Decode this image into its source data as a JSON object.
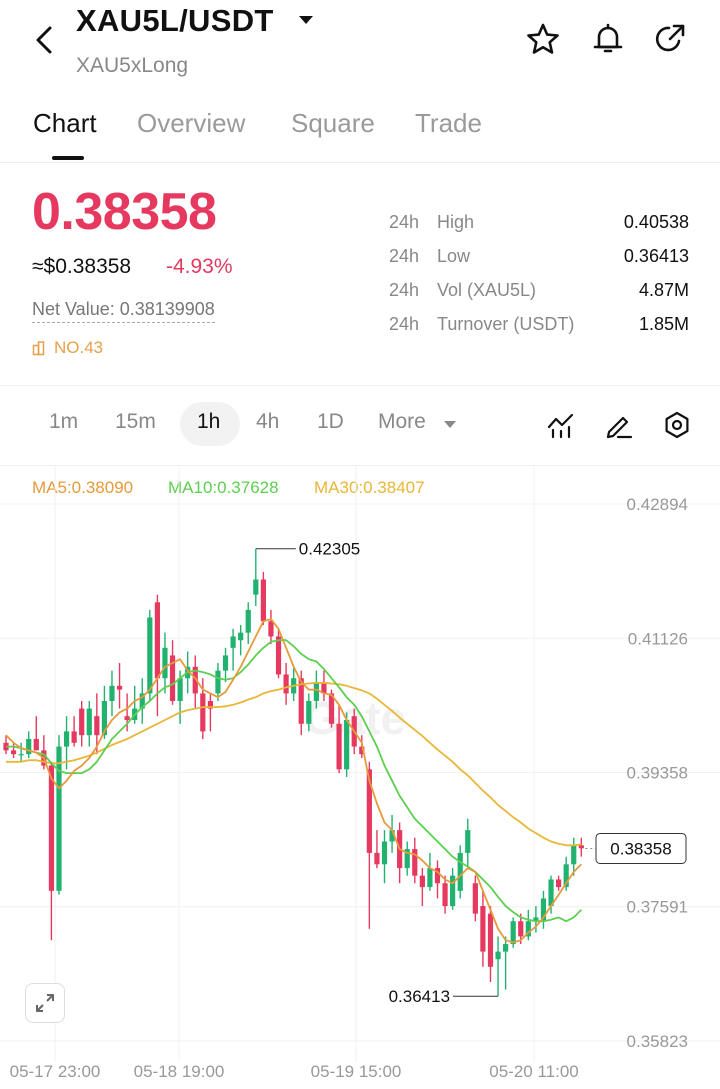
{
  "header": {
    "pair": "XAU5L/USDT",
    "subtitle": "XAU5xLong",
    "icons": [
      "back-arrow-icon",
      "star-icon",
      "bell-icon",
      "share-icon"
    ]
  },
  "tabs": [
    {
      "label": "Chart",
      "active": true
    },
    {
      "label": "Overview",
      "active": false
    },
    {
      "label": "Square",
      "active": false
    },
    {
      "label": "Trade",
      "active": false
    }
  ],
  "ticker": {
    "price": "0.38358",
    "usd_price": "≈$0.38358",
    "change": "-4.93%",
    "net_value": "Net Value: 0.38139908",
    "rank": "NO.43",
    "colors": {
      "down": "#e5395f",
      "up": "#21b26f",
      "rank": "#e7a04a"
    }
  },
  "stats": [
    {
      "period": "24h",
      "label": "High",
      "value": "0.40538"
    },
    {
      "period": "24h",
      "label": "Low",
      "value": "0.36413"
    },
    {
      "period": "24h",
      "label": "Vol (XAU5L)",
      "value": "4.87M"
    },
    {
      "period": "24h",
      "label": "Turnover (USDT)",
      "value": "1.85M"
    }
  ],
  "timeframes": [
    {
      "label": "1m",
      "active": false
    },
    {
      "label": "15m",
      "active": false
    },
    {
      "label": "1h",
      "active": true
    },
    {
      "label": "4h",
      "active": false
    },
    {
      "label": "1D",
      "active": false
    },
    {
      "label": "More",
      "active": false
    }
  ],
  "toolbar_icons": [
    "indicator-icon",
    "draw-pen-icon",
    "settings-hex-icon"
  ],
  "chart_data": {
    "type": "candlestick",
    "moving_averages": [
      {
        "name": "MA5",
        "value": "0.38090",
        "label": "MA5:0.38090",
        "color": "#e79a3c"
      },
      {
        "name": "MA10",
        "value": "0.37628",
        "label": "MA10:0.37628",
        "color": "#5ccf4f"
      },
      {
        "name": "MA30",
        "value": "0.38407",
        "label": "MA30:0.38407",
        "color": "#e9b637"
      }
    ],
    "y_ticks": [
      "0.42894",
      "0.41126",
      "0.39358",
      "0.37591",
      "0.35823"
    ],
    "x_ticks": [
      "05-17 23:00",
      "05-18 19:00",
      "05-19 15:00",
      "05-20 11:00"
    ],
    "ylim": [
      0.35823,
      0.42894
    ],
    "high_marker": "0.42305",
    "low_marker": "0.36413",
    "last_price": "0.38358",
    "watermark": "Gate",
    "candles": [
      [
        0.3975,
        0.3985,
        0.396,
        0.3965
      ],
      [
        0.3965,
        0.3975,
        0.3955,
        0.396
      ],
      [
        0.396,
        0.3975,
        0.395,
        0.396
      ],
      [
        0.396,
        0.399,
        0.3955,
        0.398
      ],
      [
        0.398,
        0.401,
        0.3965,
        0.3965
      ],
      [
        0.3965,
        0.3985,
        0.394,
        0.3945
      ],
      [
        0.3945,
        0.395,
        0.3715,
        0.378
      ],
      [
        0.378,
        0.3985,
        0.3775,
        0.397
      ],
      [
        0.397,
        0.401,
        0.394,
        0.399
      ],
      [
        0.399,
        0.401,
        0.397,
        0.3975
      ],
      [
        0.402,
        0.403,
        0.397,
        0.3985
      ],
      [
        0.3985,
        0.403,
        0.397,
        0.402
      ],
      [
        0.401,
        0.404,
        0.396,
        0.3985
      ],
      [
        0.3985,
        0.405,
        0.398,
        0.403
      ],
      [
        0.403,
        0.407,
        0.401,
        0.405
      ],
      [
        0.405,
        0.408,
        0.402,
        0.4045
      ],
      [
        0.401,
        0.404,
        0.399,
        0.4005
      ],
      [
        0.4005,
        0.405,
        0.4,
        0.402
      ],
      [
        0.402,
        0.406,
        0.4,
        0.404
      ],
      [
        0.404,
        0.415,
        0.403,
        0.414
      ],
      [
        0.416,
        0.417,
        0.401,
        0.406
      ],
      [
        0.406,
        0.412,
        0.404,
        0.41
      ],
      [
        0.409,
        0.411,
        0.4025,
        0.403
      ],
      [
        0.403,
        0.407,
        0.4,
        0.406
      ],
      [
        0.406,
        0.4095,
        0.404,
        0.4075
      ],
      [
        0.4075,
        0.409,
        0.402,
        0.404
      ],
      [
        0.404,
        0.406,
        0.398,
        0.399
      ],
      [
        0.403,
        0.404,
        0.399,
        0.402
      ],
      [
        0.404,
        0.408,
        0.403,
        0.407
      ],
      [
        0.407,
        0.41,
        0.4055,
        0.409
      ],
      [
        0.41,
        0.4125,
        0.407,
        0.4115
      ],
      [
        0.411,
        0.413,
        0.409,
        0.412
      ],
      [
        0.412,
        0.416,
        0.4105,
        0.415
      ],
      [
        0.417,
        0.42305,
        0.4155,
        0.419
      ],
      [
        0.419,
        0.42,
        0.413,
        0.4135
      ],
      [
        0.4135,
        0.415,
        0.4105,
        0.4115
      ],
      [
        0.4115,
        0.4125,
        0.406,
        0.4065
      ],
      [
        0.4065,
        0.408,
        0.4025,
        0.404
      ],
      [
        0.404,
        0.4075,
        0.403,
        0.406
      ],
      [
        0.406,
        0.407,
        0.3985,
        0.4
      ],
      [
        0.4,
        0.404,
        0.399,
        0.403
      ],
      [
        0.403,
        0.407,
        0.402,
        0.4055
      ],
      [
        0.4055,
        0.407,
        0.403,
        0.404
      ],
      [
        0.404,
        0.4045,
        0.3995,
        0.4
      ],
      [
        0.4,
        0.4025,
        0.3935,
        0.394
      ],
      [
        0.394,
        0.4015,
        0.393,
        0.4005
      ],
      [
        0.401,
        0.402,
        0.396,
        0.397
      ],
      [
        0.397,
        0.3985,
        0.3955,
        0.396
      ],
      [
        0.394,
        0.395,
        0.373,
        0.383
      ],
      [
        0.383,
        0.386,
        0.381,
        0.3815
      ],
      [
        0.3815,
        0.386,
        0.379,
        0.3845
      ],
      [
        0.3845,
        0.388,
        0.383,
        0.386
      ],
      [
        0.386,
        0.387,
        0.379,
        0.381
      ],
      [
        0.381,
        0.3845,
        0.38,
        0.3835
      ],
      [
        0.3835,
        0.385,
        0.379,
        0.38
      ],
      [
        0.38,
        0.381,
        0.376,
        0.3785
      ],
      [
        0.3785,
        0.383,
        0.378,
        0.381
      ],
      [
        0.381,
        0.382,
        0.377,
        0.379
      ],
      [
        0.379,
        0.38,
        0.375,
        0.376
      ],
      [
        0.376,
        0.381,
        0.3755,
        0.38
      ],
      [
        0.378,
        0.384,
        0.377,
        0.383
      ],
      [
        0.383,
        0.3875,
        0.381,
        0.386
      ],
      [
        0.379,
        0.38,
        0.374,
        0.375
      ],
      [
        0.376,
        0.378,
        0.368,
        0.37
      ],
      [
        0.375,
        0.376,
        0.366,
        0.368
      ],
      [
        0.369,
        0.372,
        0.36413,
        0.37
      ],
      [
        0.37,
        0.372,
        0.365,
        0.371
      ],
      [
        0.371,
        0.3745,
        0.3705,
        0.374
      ],
      [
        0.374,
        0.375,
        0.371,
        0.372
      ],
      [
        0.372,
        0.3755,
        0.3715,
        0.374
      ],
      [
        0.374,
        0.376,
        0.3725,
        0.3745
      ],
      [
        0.374,
        0.378,
        0.373,
        0.377
      ],
      [
        0.376,
        0.38,
        0.375,
        0.3795
      ],
      [
        0.3795,
        0.38,
        0.378,
        0.3785
      ],
      [
        0.3785,
        0.3825,
        0.378,
        0.3815
      ],
      [
        0.3815,
        0.385,
        0.38,
        0.384
      ],
      [
        0.384,
        0.385,
        0.3825,
        0.3836
      ]
    ],
    "ma5": [
      0.3985,
      0.3975,
      0.3968,
      0.3965,
      0.3962,
      0.3955,
      0.3928,
      0.3915,
      0.3925,
      0.3938,
      0.3945,
      0.3955,
      0.397,
      0.399,
      0.4005,
      0.4015,
      0.402,
      0.403,
      0.4035,
      0.4045,
      0.406,
      0.4075,
      0.408,
      0.4085,
      0.407,
      0.406,
      0.4045,
      0.404,
      0.4035,
      0.4042,
      0.4058,
      0.4075,
      0.4095,
      0.4115,
      0.4135,
      0.4138,
      0.4125,
      0.41,
      0.4075,
      0.4055,
      0.4045,
      0.4045,
      0.404,
      0.4038,
      0.4025,
      0.4005,
      0.399,
      0.3975,
      0.3925,
      0.3895,
      0.387,
      0.386,
      0.3835,
      0.383,
      0.3828,
      0.382,
      0.381,
      0.3805,
      0.3795,
      0.379,
      0.38,
      0.381,
      0.3805,
      0.378,
      0.3755,
      0.373,
      0.3715,
      0.3712,
      0.3715,
      0.3725,
      0.3733,
      0.3745,
      0.376,
      0.3775,
      0.379,
      0.3805,
      0.3815
    ],
    "ma10": [
      0.397,
      0.397,
      0.3968,
      0.3965,
      0.3962,
      0.396,
      0.3948,
      0.3938,
      0.3935,
      0.3935,
      0.3935,
      0.394,
      0.395,
      0.3965,
      0.398,
      0.399,
      0.4,
      0.4012,
      0.4022,
      0.403,
      0.404,
      0.4048,
      0.4052,
      0.406,
      0.4068,
      0.407,
      0.4068,
      0.4065,
      0.406,
      0.4058,
      0.406,
      0.4068,
      0.4078,
      0.409,
      0.41,
      0.4108,
      0.411,
      0.411,
      0.4102,
      0.4092,
      0.4085,
      0.4082,
      0.4072,
      0.406,
      0.4048,
      0.4035,
      0.4025,
      0.401,
      0.399,
      0.397,
      0.3945,
      0.3925,
      0.3905,
      0.389,
      0.3875,
      0.3865,
      0.3855,
      0.3845,
      0.3835,
      0.3825,
      0.3818,
      0.3812,
      0.3805,
      0.3795,
      0.3785,
      0.3772,
      0.376,
      0.3752,
      0.3745,
      0.3742,
      0.374,
      0.374,
      0.3742,
      0.3745,
      0.374,
      0.3745,
      0.3755
    ],
    "ma30": [
      0.395,
      0.395,
      0.395,
      0.3952,
      0.3952,
      0.395,
      0.3948,
      0.3948,
      0.395,
      0.3952,
      0.3955,
      0.3958,
      0.3962,
      0.3967,
      0.3972,
      0.3976,
      0.398,
      0.3985,
      0.399,
      0.3995,
      0.4,
      0.4005,
      0.401,
      0.4015,
      0.4018,
      0.402,
      0.4022,
      0.4022,
      0.4022,
      0.4023,
      0.4025,
      0.4028,
      0.4032,
      0.4035,
      0.404,
      0.4043,
      0.4045,
      0.4048,
      0.405,
      0.4052,
      0.4053,
      0.4054,
      0.4054,
      0.4053,
      0.4052,
      0.405,
      0.4047,
      0.4044,
      0.404,
      0.4033,
      0.4025,
      0.4017,
      0.4008,
      0.4,
      0.3992,
      0.3984,
      0.3975,
      0.3966,
      0.3958,
      0.395,
      0.394,
      0.3932,
      0.3922,
      0.3912,
      0.3903,
      0.3893,
      0.3885,
      0.3877,
      0.387,
      0.3862,
      0.3856,
      0.385,
      0.3845,
      0.3842,
      0.384,
      0.384,
      0.3841
    ]
  }
}
